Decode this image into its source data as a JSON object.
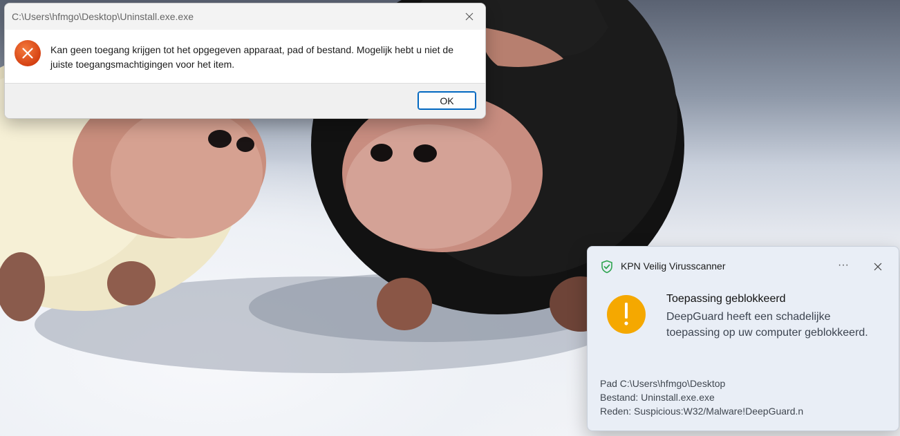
{
  "error_dialog": {
    "title": "C:\\Users\\hfmgo\\Desktop\\Uninstall.exe.exe",
    "message": "Kan geen toegang krijgen tot het opgegeven apparaat, pad of bestand. Mogelijk hebt u niet de juiste toegangsmachtigingen voor het item.",
    "ok_label": "OK",
    "icon": "error-x-icon",
    "colors": {
      "icon": "#e2470f",
      "button_border": "#0067c0"
    }
  },
  "toast": {
    "app_name": "KPN Veilig Virusscanner",
    "more_label": "···",
    "title": "Toepassing geblokkeerd",
    "text": "DeepGuard heeft een schadelijke toepassing op uw computer geblokkeerd.",
    "details": [
      "Pad C:\\Users\\hfmgo\\Desktop",
      "Bestand: Uninstall.exe.exe",
      "Reden: Suspicious:W32/Malware!DeepGuard.n"
    ],
    "icons": {
      "app": "shield-check-icon",
      "status": "warning-icon"
    },
    "colors": {
      "shield": "#2ea44f",
      "warning": "#f5a800"
    }
  }
}
